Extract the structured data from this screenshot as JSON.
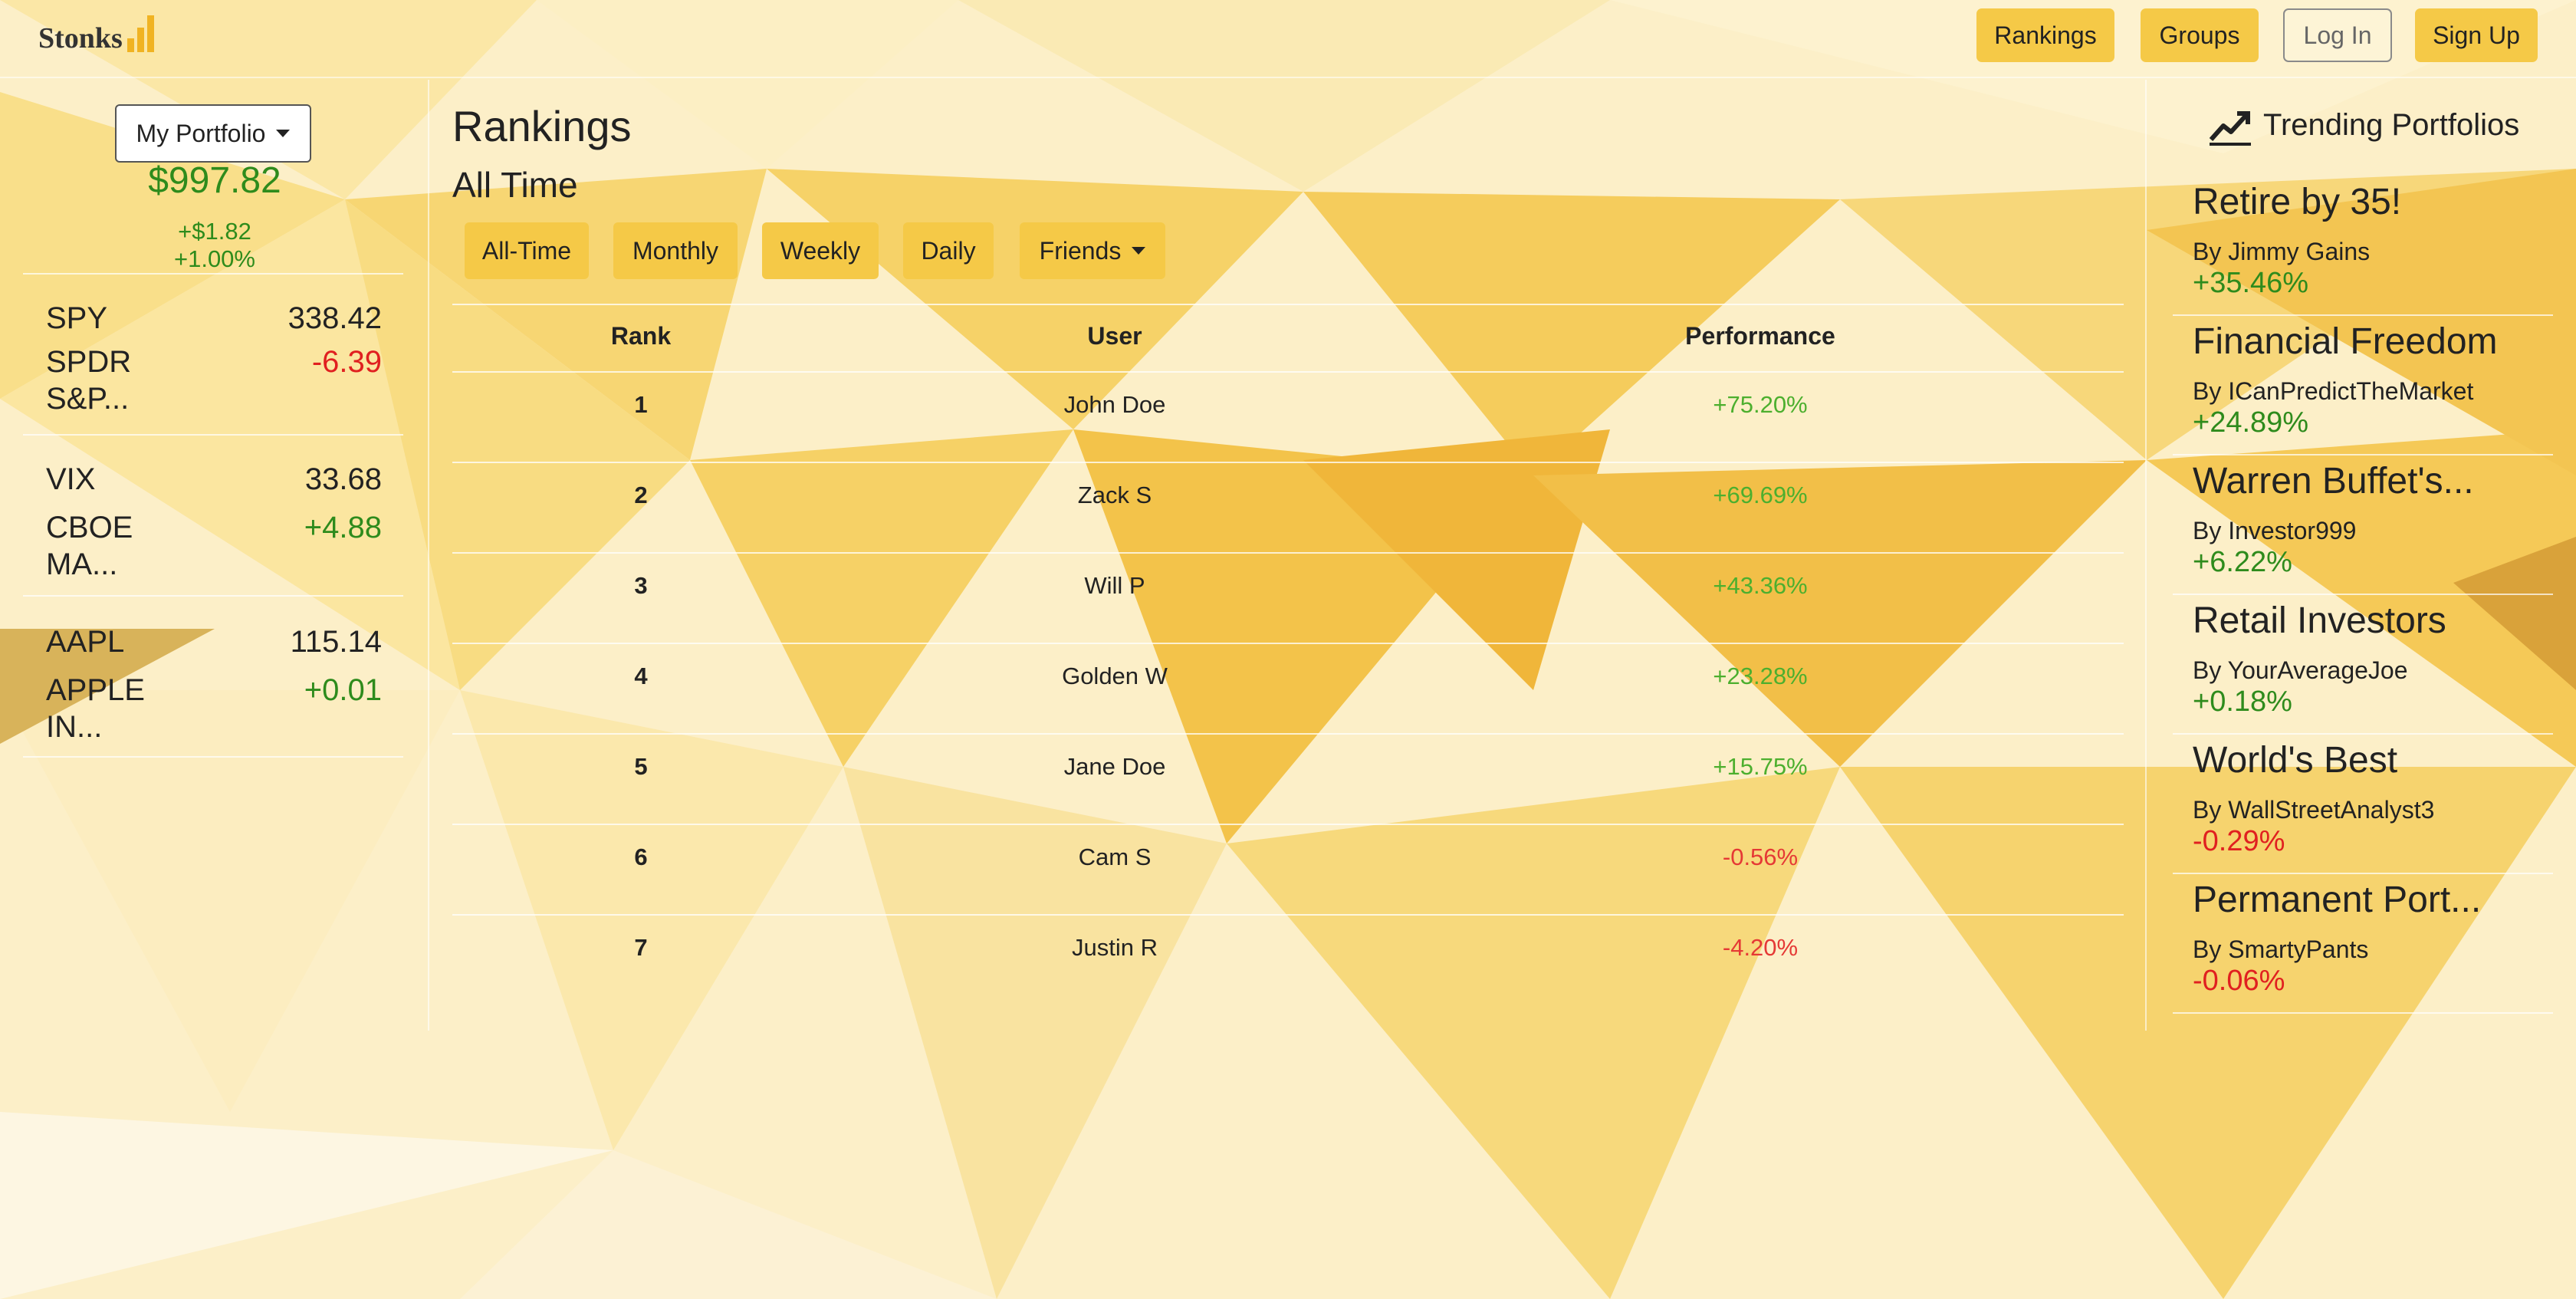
{
  "app": {
    "brand": "Stonks",
    "accent_color": "#f5c947",
    "positive_color": "#2e8b1c",
    "negative_color": "#e02020"
  },
  "nav": {
    "rankings": "Rankings",
    "groups": "Groups",
    "login": "Log In",
    "signup": "Sign Up"
  },
  "portfolio": {
    "selector_label": "My Portfolio",
    "total": "$997.82",
    "change_abs": "+$1.82",
    "change_pct": "+1.00%"
  },
  "tickers": [
    {
      "symbol": "SPY",
      "price": "338.42",
      "name_line1": "SPDR",
      "name_line2": "S&P...",
      "change": "-6.39"
    },
    {
      "symbol": "VIX",
      "price": "33.68",
      "name_line1": "CBOE",
      "name_line2": "MA...",
      "change": "+4.88"
    },
    {
      "symbol": "AAPL",
      "price": "115.14",
      "name_line1": "APPLE",
      "name_line2": "IN...",
      "change": "+0.01"
    }
  ],
  "rankings": {
    "title": "Rankings",
    "period": "All Time",
    "filters": [
      "All-Time",
      "Monthly",
      "Weekly",
      "Daily"
    ],
    "scope": "Friends",
    "columns": [
      "Rank",
      "User",
      "Performance"
    ],
    "rows": [
      {
        "rank": "1",
        "user": "John Doe",
        "performance": "+75.20%"
      },
      {
        "rank": "2",
        "user": "Zack S",
        "performance": "+69.69%"
      },
      {
        "rank": "3",
        "user": "Will P",
        "performance": "+43.36%"
      },
      {
        "rank": "4",
        "user": "Golden W",
        "performance": "+23.28%"
      },
      {
        "rank": "5",
        "user": "Jane Doe",
        "performance": "+15.75%"
      },
      {
        "rank": "6",
        "user": "Cam S",
        "performance": "-0.56%"
      },
      {
        "rank": "7",
        "user": "Justin R",
        "performance": "-4.20%"
      }
    ]
  },
  "trending": {
    "heading": "Trending Portfolios",
    "icon": "trending-up-icon",
    "items": [
      {
        "title": "Retire by 35!",
        "author": "By Jimmy Gains",
        "performance": "+35.46%"
      },
      {
        "title": "Financial Freedom",
        "author": "By ICanPredictTheMarket",
        "performance": "+24.89%"
      },
      {
        "title": "Warren Buffet's...",
        "author": "By Investor999",
        "performance": "+6.22%"
      },
      {
        "title": "Retail Investors",
        "author": "By YourAverageJoe",
        "performance": "+0.18%"
      },
      {
        "title": "World's Best",
        "author": "By WallStreetAnalyst3",
        "performance": "-0.29%"
      },
      {
        "title": "Permanent Port...",
        "author": "By SmartyPants",
        "performance": "-0.06%"
      }
    ]
  }
}
